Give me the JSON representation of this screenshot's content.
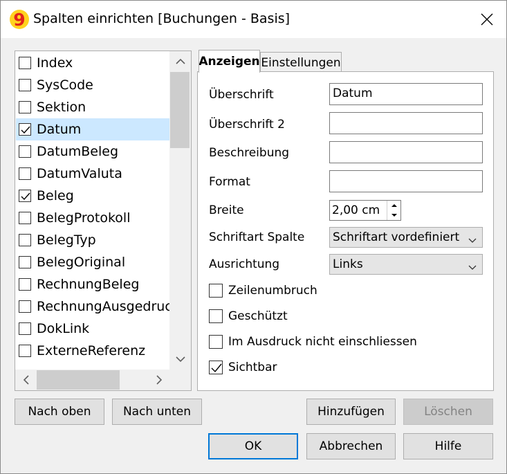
{
  "window": {
    "title": "Spalten einrichten [Buchungen - Basis]"
  },
  "column_list": {
    "items": [
      {
        "label": "Index",
        "checked": false,
        "selected": false
      },
      {
        "label": "SysCode",
        "checked": false,
        "selected": false
      },
      {
        "label": "Sektion",
        "checked": false,
        "selected": false
      },
      {
        "label": "Datum",
        "checked": true,
        "selected": true
      },
      {
        "label": "DatumBeleg",
        "checked": false,
        "selected": false
      },
      {
        "label": "DatumValuta",
        "checked": false,
        "selected": false
      },
      {
        "label": "Beleg",
        "checked": true,
        "selected": false
      },
      {
        "label": "BelegProtokoll",
        "checked": false,
        "selected": false
      },
      {
        "label": "BelegTyp",
        "checked": false,
        "selected": false
      },
      {
        "label": "BelegOriginal",
        "checked": false,
        "selected": false
      },
      {
        "label": "RechnungBeleg",
        "checked": false,
        "selected": false
      },
      {
        "label": "RechnungAusgedruc",
        "checked": false,
        "selected": false
      },
      {
        "label": "DokLink",
        "checked": false,
        "selected": false
      },
      {
        "label": "ExterneReferenz",
        "checked": false,
        "selected": false
      }
    ]
  },
  "tabs": [
    {
      "label": "Anzeigen",
      "active": true
    },
    {
      "label": "Einstellungen",
      "active": false
    }
  ],
  "form": {
    "heading_label": "Überschrift",
    "heading_value": "Datum",
    "heading2_label": "Überschrift 2",
    "heading2_value": "",
    "description_label": "Beschreibung",
    "description_value": "",
    "format_label": "Format",
    "format_value": "",
    "width_label": "Breite",
    "width_value": "2,00 cm",
    "font_label": "Schriftart Spalte",
    "font_value": "Schriftart vordefiniert",
    "align_label": "Ausrichtung",
    "align_value": "Links",
    "options": [
      {
        "label": "Zeilenumbruch",
        "checked": false
      },
      {
        "label": "Geschützt",
        "checked": false
      },
      {
        "label": "Im Ausdruck nicht einschliessen",
        "checked": false
      },
      {
        "label": "Sichtbar",
        "checked": true
      }
    ]
  },
  "buttons": {
    "move_up": "Nach oben",
    "move_down": "Nach unten",
    "add": "Hinzufügen",
    "delete": "Löschen",
    "ok": "OK",
    "cancel": "Abbrechen",
    "help": "Hilfe"
  },
  "colors": {
    "selection": "#cce8ff",
    "default_button_border": "#0078d7",
    "app_icon": "#e2231a"
  }
}
